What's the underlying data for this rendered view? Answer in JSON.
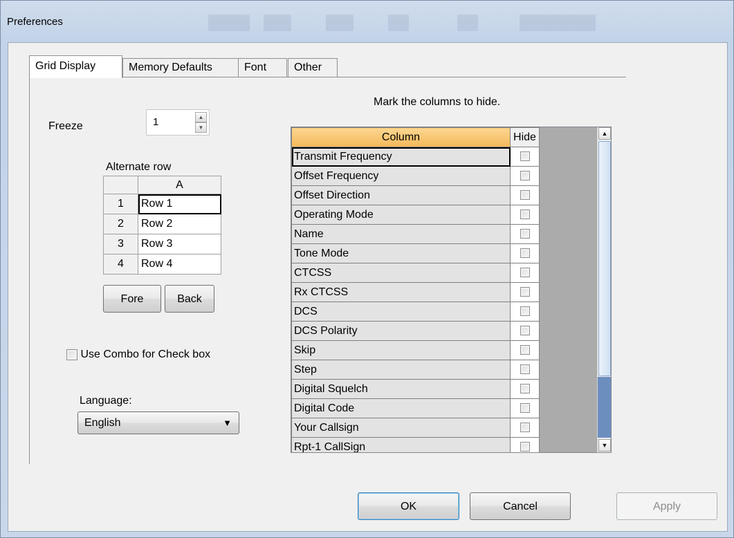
{
  "window": {
    "title": "Preferences"
  },
  "tabs": [
    {
      "label": "Grid Display"
    },
    {
      "label": "Memory Defaults"
    },
    {
      "label": "Font"
    },
    {
      "label": "Other"
    }
  ],
  "freeze": {
    "label": "Freeze",
    "value": "1"
  },
  "alternate_row": {
    "label": "Alternate row",
    "column_header": "A",
    "rows": [
      {
        "num": "1",
        "value": "Row 1"
      },
      {
        "num": "2",
        "value": "Row 2"
      },
      {
        "num": "3",
        "value": "Row 3"
      },
      {
        "num": "4",
        "value": "Row 4"
      }
    ],
    "fore_label": "Fore",
    "back_label": "Back"
  },
  "combo_checkbox": {
    "label": "Use Combo for Check box",
    "checked": false
  },
  "language": {
    "label": "Language:",
    "value": "English"
  },
  "columns_panel": {
    "instruction": "Mark the columns to hide.",
    "header_column": "Column",
    "header_hide": "Hide",
    "rows": [
      "Transmit Frequency",
      "Offset Frequency",
      "Offset Direction",
      "Operating Mode",
      "Name",
      "Tone Mode",
      "CTCSS",
      "Rx CTCSS",
      "DCS",
      "DCS Polarity",
      "Skip",
      "Step",
      "Digital Squelch",
      "Digital Code",
      "Your Callsign",
      "Rpt-1 CallSign"
    ]
  },
  "buttons": {
    "ok": "OK",
    "cancel": "Cancel",
    "apply": "Apply"
  },
  "icons": {
    "spin_up": "triangle-up-icon",
    "spin_down": "triangle-down-icon",
    "combo_arrow": "chevron-down-icon",
    "scroll_up": "scroll-up-icon",
    "scroll_down": "scroll-down-icon"
  },
  "colors": {
    "header_orange": "#f5b85a",
    "scroll_selected": "#6c8ebf",
    "window_frame": "#c3d3e8"
  }
}
